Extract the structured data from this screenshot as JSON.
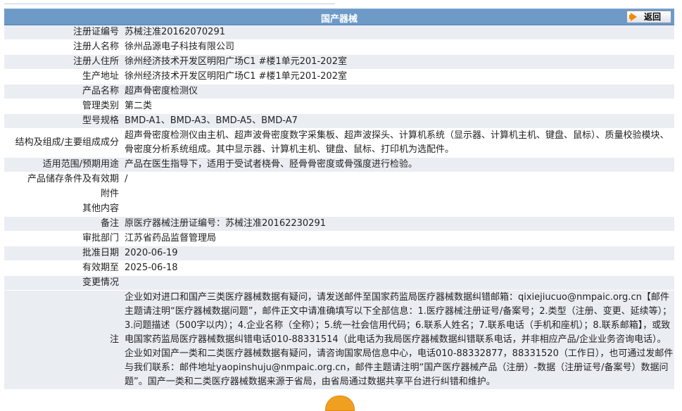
{
  "header": {
    "title": "国产器械",
    "back_label": "返回",
    "bar_color": "#6e9ac8"
  },
  "rows": [
    {
      "label": "注册证编号",
      "value": "苏械注准20162070291"
    },
    {
      "label": "注册人名称",
      "value": "徐州品源电子科技有限公司"
    },
    {
      "label": "注册人住所",
      "value": "徐州经济技术开发区明阳广场C1 #楼1单元201-202室"
    },
    {
      "label": "生产地址",
      "value": "徐州经济技术开发区明阳广场C1 #楼1单元201-202室"
    },
    {
      "label": "产品名称",
      "value": "超声骨密度检测仪"
    },
    {
      "label": "管理类别",
      "value": "第二类"
    },
    {
      "label": "型号规格",
      "value": "BMD-A1、BMD-A3、BMD-A5、BMD-A7"
    },
    {
      "label": "结构及组成/主要组成成分",
      "value": "超声骨密度检测仪由主机、超声波骨密度数字采集板、超声波探头、计算机系统（显示器、计算机主机、键盘、鼠标）、质量校验模块、骨密度分析系统组成。其中显示器、计算机主机、键盘、鼠标、打印机为选配件。"
    },
    {
      "label": "适用范围/预期用途",
      "value": "产品在医生指导下，适用于受试者桡骨、胫骨骨密度或骨强度进行检验。"
    },
    {
      "label": "产品储存条件及有效期",
      "value": "/"
    },
    {
      "label": "附件",
      "value": ""
    },
    {
      "label": "其他内容",
      "value": ""
    },
    {
      "label": "备注",
      "value": "原医疗器械注册证编号：苏械注准20162230291"
    },
    {
      "label": "审批部门",
      "value": "江苏省药品监督管理局"
    },
    {
      "label": "批准日期",
      "value": "2020-06-19"
    },
    {
      "label": "有效期至",
      "value": "2025-06-18"
    },
    {
      "label": "变更情况",
      "value": ""
    }
  ],
  "note": {
    "label": "注",
    "text": "企业如对进口和国产三类医疗器械数据有疑问，请发送邮件至国家药监局医疗器械数据纠错邮箱：qixiejiucuo@nmpaic.org.cn【邮件主题请注明“医疗器械数据问题”，邮件正文中请准确填写以下全部信息：1.医疗器械注册证号/备案号；2.类型（注册、变更、延续等）；3.问题描述（500字以内）；4.企业名称（全称）；5.统一社会信用代码；6.联系人姓名；7.联系电话（手机和座机）；8.联系邮箱】，或致电国家药监局医疗器械数据纠错电话010-88331514（此电话为我局医疗器械数据纠错联系电话，并非相应产品/企业业务咨询电话）。企业如对国产一类和二类医疗器械数据有疑问，请咨询国家局信息中心，电话010-88332877，88331520（工作日），也可通过发邮件与我们联系：邮件地址yaopinshuju@nmpaic.org.cn，邮件主题请注明“国产医疗器械产品（注册）-数据（注册证号/备案号）数据问题”。国产一类和二类医疗器械数据来源于省局，由省局通过数据共享平台进行纠错和维护。"
  }
}
